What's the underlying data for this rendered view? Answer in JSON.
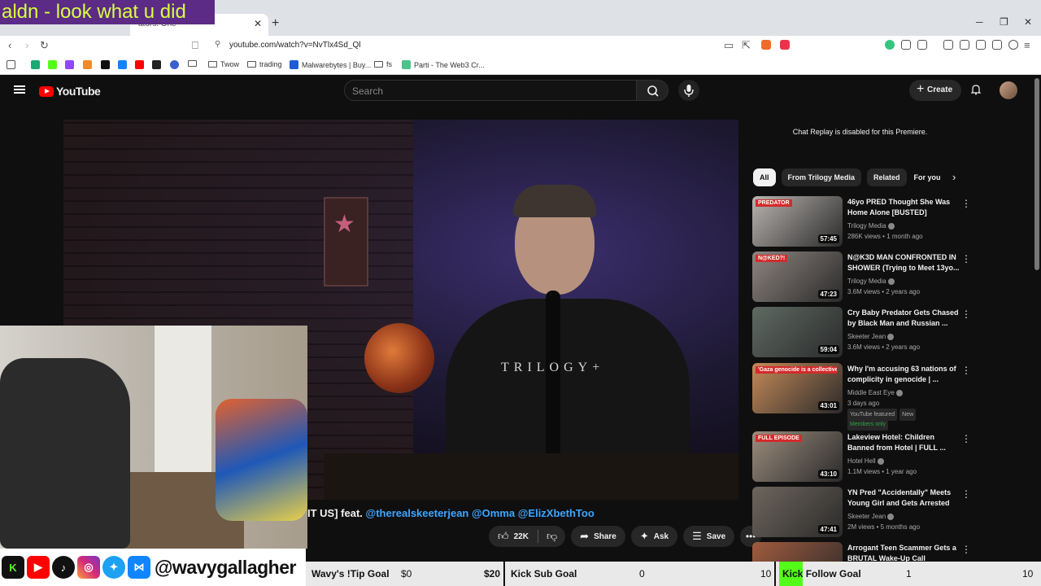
{
  "browser": {
    "tab_title": "ators. One",
    "url": "youtube.com/watch?v=NvTlx4Sd_Ql",
    "bookmarks": [
      "Twow",
      "trading",
      "Malwarebytes | Buy...",
      "fs",
      "Parti - The Web3 Cr..."
    ]
  },
  "overlay": {
    "banner_text": "aldn - look what u did",
    "handle": "@wavygallagher"
  },
  "youtube": {
    "logo": "YouTube",
    "search_placeholder": "Search",
    "create_label": "Create"
  },
  "video": {
    "title_prefix": "IT US] feat. ",
    "mentions": "@therealskeeterjean @Omma @ElizXbethToo",
    "brand_text": "TRILOGY+",
    "actions": {
      "likes": "22K",
      "share": "Share",
      "ask": "Ask",
      "save": "Save"
    }
  },
  "goals": {
    "tip": {
      "label": "Wavy's !Tip Goal",
      "current": "$0",
      "target": "$20"
    },
    "sub": {
      "label": "Kick Sub Goal",
      "current": "0",
      "target": "10"
    },
    "follow": {
      "label_kick": "Kick",
      "label_rest": " Follow Goal",
      "current": "1",
      "target": "10"
    }
  },
  "sidebar": {
    "chat_note": "Chat Replay is disabled for this Premiere.",
    "chips": [
      "All",
      "From Trilogy Media",
      "Related",
      "For you"
    ],
    "recommendations": [
      {
        "title": "46yo PRED Thought She Was Home Alone [BUSTED]",
        "channel": "Trilogy Media",
        "meta": "286K views • 1 month ago",
        "duration": "57:45",
        "thumb_color": "#b9b4b0",
        "badge": "PREDATOR"
      },
      {
        "title": "N@K3D MAN CONFRONTED IN SHOWER (Trying to Meet 13yo...",
        "channel": "Trilogy Media",
        "meta": "3.6M views • 2 years ago",
        "duration": "47:23",
        "thumb_color": "#8e8580",
        "badge": "N@KED?!"
      },
      {
        "title": "Cry Baby Predator Gets Chased by Black Man and Russian ...",
        "channel": "Skeeter Jean",
        "meta": "3.6M views • 2 years ago",
        "duration": "59:04",
        "thumb_color": "#5f6a63",
        "badge": ""
      },
      {
        "title": "Why I'm accusing 63 nations of complicity in genocide | ...",
        "channel": "Middle East Eye",
        "meta": "3 days ago",
        "duration": "43:01",
        "thumb_color": "#c58a58",
        "badge": "'Gaza genocide is a collective cri'",
        "featured": "YouTube featured",
        "new": "New",
        "members": "Members only"
      },
      {
        "title": "Lakeview Hotel: Children Banned from Hotel | FULL ...",
        "channel": "Hotel Hell",
        "meta": "1.1M views • 1 year ago",
        "duration": "43:10",
        "thumb_color": "#9c8d7d",
        "badge": "FULL EPISODE"
      },
      {
        "title": "YN Pred \"Accidentally\" Meets Young Girl and Gets Arrested",
        "channel": "Skeeter Jean",
        "meta": "2M views • 5 months ago",
        "duration": "47:41",
        "thumb_color": "#6e665d",
        "badge": ""
      },
      {
        "title": "Arrogant Teen Scammer Gets a BRUTAL Wake-Up Call",
        "channel": "",
        "meta": "",
        "duration": "",
        "thumb_color": "#a15b3e",
        "badge": ""
      }
    ]
  }
}
